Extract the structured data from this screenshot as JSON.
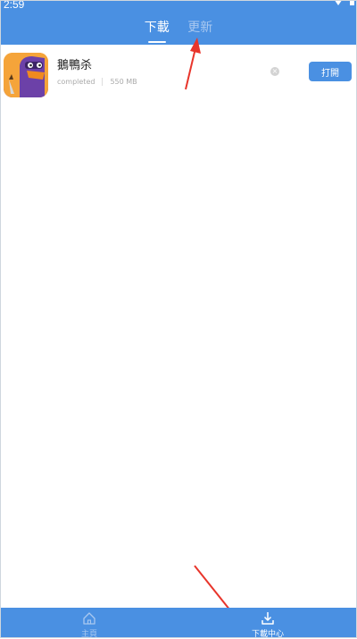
{
  "status_bar": {
    "time": "2:59"
  },
  "tabs": [
    {
      "label": "下載",
      "active": true
    },
    {
      "label": "更新",
      "active": false
    }
  ],
  "downloads": [
    {
      "name": "鵝鴨杀",
      "status": "completed",
      "size": "550 MB",
      "action_label": "打開"
    }
  ],
  "bottom_nav": {
    "home_label": "主頁",
    "download_label": "下載中心"
  },
  "colors": {
    "primary": "#4a90e2",
    "annotation_arrow": "#e8352b"
  },
  "icons": {
    "home": "home-icon",
    "download": "download-icon",
    "cancel": "close-circle-icon"
  }
}
